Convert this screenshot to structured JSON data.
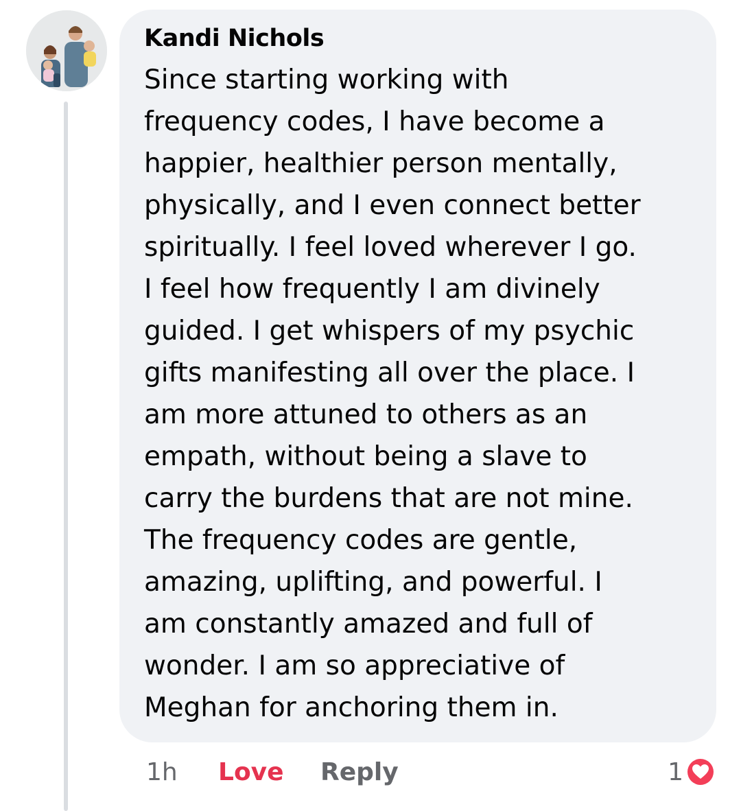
{
  "comment": {
    "author": "Kandi Nichols",
    "avatar_icon": "profile-photo",
    "text": "Since starting working with\nfrequency codes, I have become a\nhappier, healthier person mentally,\nphysically, and I even connect better\nspiritually. I feel loved wherever I go.\nI feel how frequently I am divinely\nguided. I get whispers of my psychic\ngifts manifesting all over the place. I\nam more attuned to others as an\nempath, without being a slave to\ncarry the burdens that are not mine.\nThe frequency codes are gentle,\namazing, uplifting, and powerful. I\nam constantly amazed and full of\nwonder. I am so appreciative of\nMeghan for anchoring them in."
  },
  "actions": {
    "time": "1h",
    "love_label": "Love",
    "reply_label": "Reply"
  },
  "reactions": {
    "count": "1",
    "icon": "love-reaction-icon"
  },
  "colors": {
    "bubble_bg": "#f0f2f5",
    "love_accent": "#e5334f",
    "muted_text": "#65676b"
  }
}
